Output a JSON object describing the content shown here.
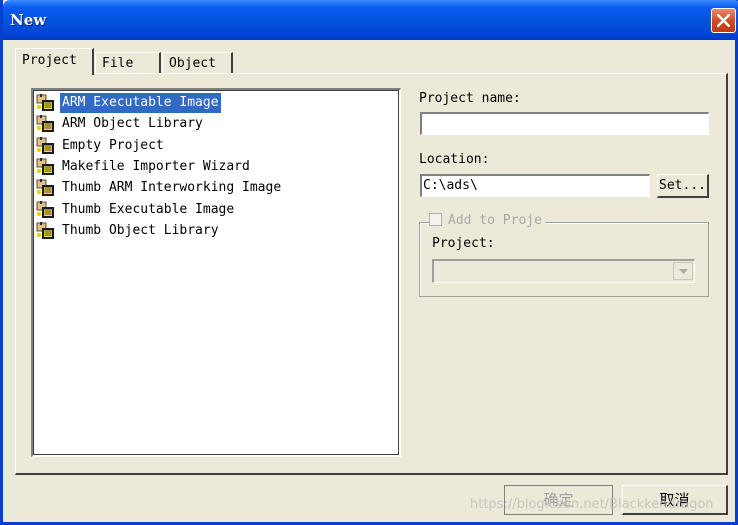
{
  "window": {
    "title": "New"
  },
  "tabs": [
    {
      "label": "Project"
    },
    {
      "label": "File"
    },
    {
      "label": "Object"
    }
  ],
  "project_types": [
    {
      "label": "ARM Executable Image",
      "selected": true
    },
    {
      "label": "ARM Object Library"
    },
    {
      "label": "Empty Project"
    },
    {
      "label": "Makefile Importer Wizard"
    },
    {
      "label": "Thumb ARM Interworking Image"
    },
    {
      "label": "Thumb Executable Image"
    },
    {
      "label": "Thumb Object Library"
    }
  ],
  "form": {
    "project_name_label": "Project name:",
    "project_name_value": "",
    "location_label": "Location:",
    "location_value": "C:\\ads\\",
    "set_button": "Set...",
    "add_to_project_label": "Add to Proje",
    "project_label": "Project:",
    "project_select_value": ""
  },
  "buttons": {
    "ok": "确定",
    "cancel": "取消"
  },
  "watermark": "https://blog.csdn.net/Blackkendragon"
}
